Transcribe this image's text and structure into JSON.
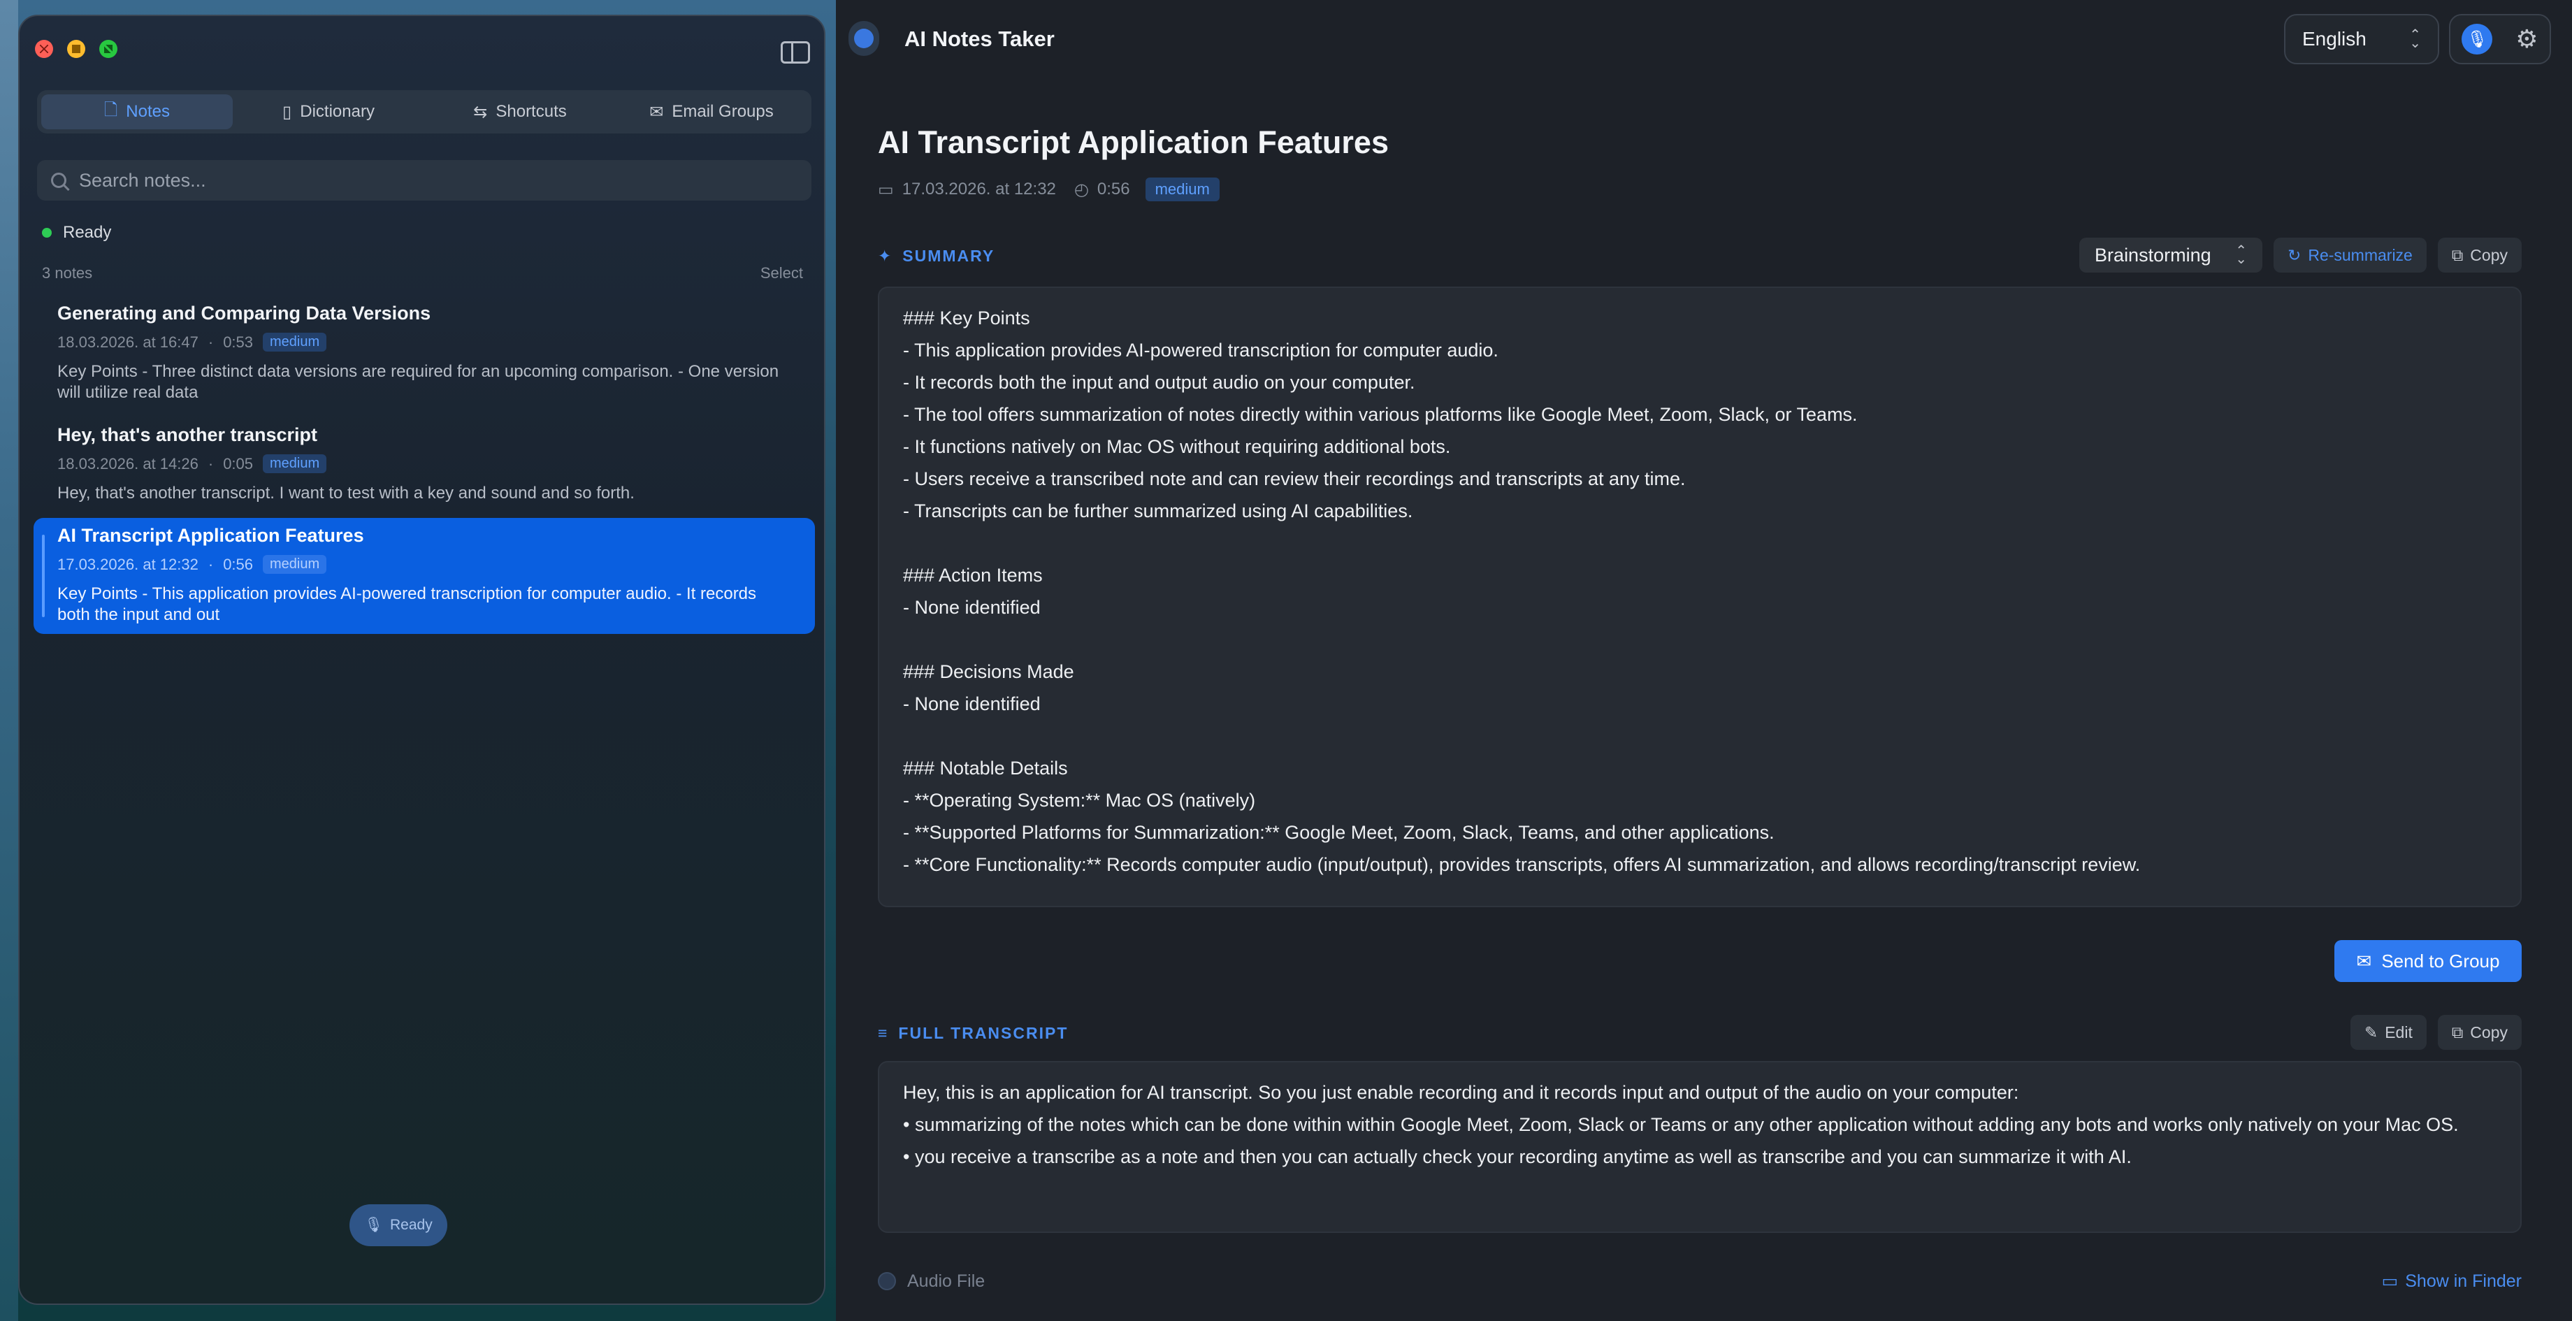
{
  "sidebar": {
    "tabs": [
      {
        "label": "Notes",
        "icon": "document-icon"
      },
      {
        "label": "Dictionary",
        "icon": "book-icon"
      },
      {
        "label": "Shortcuts",
        "icon": "arrows-icon"
      },
      {
        "label": "Email Groups",
        "icon": "envelope-icon"
      }
    ],
    "search_placeholder": "Search notes...",
    "status": "Ready",
    "count": "3 notes",
    "select_label": "Select",
    "notes": [
      {
        "title": "Generating and Comparing Data Versions",
        "date": "18.03.2026. at 16:47",
        "sep": "·",
        "duration": "0:53",
        "badge": "medium",
        "snippet": "Key Points - Three distinct data versions are required for an upcoming comparison. - One version will utilize real data"
      },
      {
        "title": "Hey, that's another transcript",
        "date": "18.03.2026. at 14:26",
        "sep": "·",
        "duration": "0:05",
        "badge": "medium",
        "snippet": "Hey, that's another transcript. I want to test with a key and sound and so forth."
      },
      {
        "title": "AI Transcript Application Features",
        "date": "17.03.2026. at 12:32",
        "sep": "·",
        "duration": "0:56",
        "badge": "medium",
        "snippet": "Key Points - This application provides AI-powered transcription for computer audio. - It records both the input and out"
      }
    ],
    "ready_pill": "Ready"
  },
  "header": {
    "app_title": "AI Notes Taker",
    "language": "English"
  },
  "document": {
    "title": "AI Transcript Application Features",
    "date": "17.03.2026. at 12:32",
    "duration": "0:56",
    "badge": "medium"
  },
  "summary": {
    "heading": "SUMMARY",
    "style": "Brainstorming",
    "resummarize_label": "Re-summarize",
    "copy_label": "Copy",
    "lines": [
      "### Key Points",
      "- This application provides AI-powered transcription for computer audio.",
      "- It records both the input and output audio on your computer.",
      "- The tool offers summarization of notes directly within various platforms like Google Meet, Zoom, Slack, or Teams.",
      "- It functions natively on Mac OS without requiring additional bots.",
      "- Users receive a transcribed note and can review their recordings and transcripts at any time.",
      "- Transcripts can be further summarized using AI capabilities.",
      "",
      "### Action Items",
      "- None identified",
      "",
      "### Decisions Made",
      "- None identified",
      "",
      "### Notable Details",
      "- **Operating System:** Mac OS (natively)",
      "- **Supported Platforms for Summarization:** Google Meet, Zoom, Slack, Teams, and other applications.",
      "- **Core Functionality:** Records computer audio (input/output), provides transcripts, offers AI summarization, and allows recording/transcript review."
    ]
  },
  "send_to_group_label": "Send to Group",
  "transcript": {
    "heading": "FULL TRANSCRIPT",
    "edit_label": "Edit",
    "copy_label": "Copy",
    "lines": [
      "Hey, this is an application for AI transcript. So you just enable recording and it records input and output of the audio on your computer:",
      "• summarizing of the notes which can be done within within Google Meet, Zoom, Slack or Teams or any other application without adding any bots and works only natively on your Mac OS.",
      "• you receive a transcribe as a note and then you can actually check your recording anytime as well as transcribe and you can summarize it with AI."
    ]
  },
  "audio": {
    "label": "Audio File",
    "show_in_finder": "Show in Finder"
  },
  "colors": {
    "accent": "#2f7af0",
    "selected_note": "#0a5fe0",
    "status_green": "#2ecc55"
  }
}
